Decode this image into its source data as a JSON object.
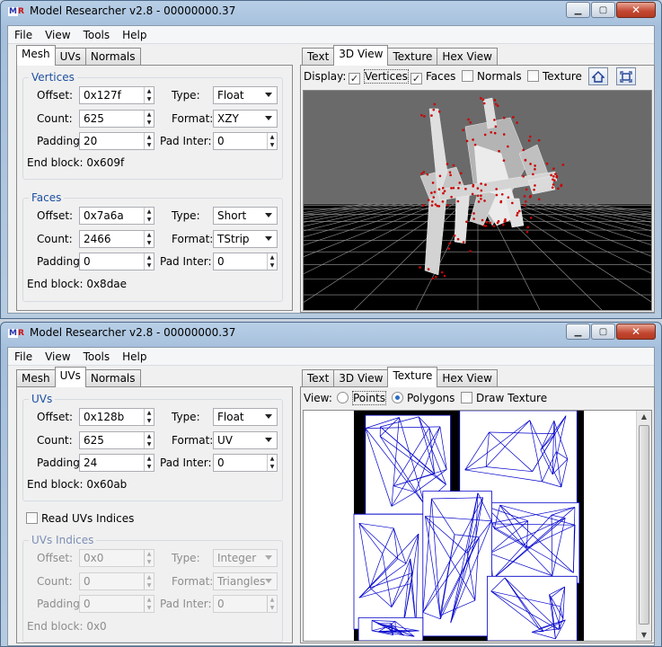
{
  "window1": {
    "title": "Model Researcher v2.8 - 00000000.37",
    "menu": [
      "File",
      "View",
      "Tools",
      "Help"
    ],
    "left_tabs": [
      "Mesh",
      "UVs",
      "Normals"
    ],
    "left_active": "Mesh",
    "vertices": {
      "title": "Vertices",
      "offset_label": "Offset:",
      "offset": "0x127f",
      "count_label": "Count:",
      "count": "625",
      "padding_label": "Padding:",
      "padding": "20",
      "type_label": "Type:",
      "type": "Float",
      "format_label": "Format:",
      "format": "XZY",
      "padinter_label": "Pad Inter:",
      "padinter": "0",
      "endblock": "End block: 0x609f"
    },
    "faces": {
      "title": "Faces",
      "offset_label": "Offset:",
      "offset": "0x7a6a",
      "count_label": "Count:",
      "count": "2466",
      "padding_label": "Padding:",
      "padding": "0",
      "type_label": "Type:",
      "type": "Short",
      "format_label": "Format:",
      "format": "TStrip",
      "padinter_label": "Pad Inter:",
      "padinter": "0",
      "endblock": "End block: 0x8dae"
    },
    "right_tabs": [
      "Text",
      "3D View",
      "Texture",
      "Hex View"
    ],
    "right_active": "3D View",
    "display_label": "Display:",
    "display_options": [
      {
        "label": "Vertices",
        "checked": true
      },
      {
        "label": "Faces",
        "checked": true
      },
      {
        "label": "Normals",
        "checked": false
      },
      {
        "label": "Texture",
        "checked": false
      }
    ]
  },
  "window2": {
    "title": "Model Researcher v2.8 - 00000000.37",
    "menu": [
      "File",
      "View",
      "Tools",
      "Help"
    ],
    "left_tabs": [
      "Mesh",
      "UVs",
      "Normals"
    ],
    "left_active": "UVs",
    "uvs": {
      "title": "UVs",
      "offset_label": "Offset:",
      "offset": "0x128b",
      "count_label": "Count:",
      "count": "625",
      "padding_label": "Padding:",
      "padding": "24",
      "type_label": "Type:",
      "type": "Float",
      "format_label": "Format:",
      "format": "UV",
      "padinter_label": "Pad Inter:",
      "padinter": "0",
      "endblock": "End block: 0x60ab"
    },
    "read_uv_indices": "Read UVs Indices",
    "uv_indices": {
      "title": "UVs Indices",
      "offset_label": "Offset:",
      "offset": "0x0",
      "count_label": "Count:",
      "count": "0",
      "padding_label": "Padding:",
      "padding": "0",
      "type_label": "Type:",
      "type": "Integer",
      "format_label": "Format:",
      "format": "Triangles",
      "padinter_label": "Pad Inter:",
      "padinter": "0",
      "endblock": "End block: 0x0"
    },
    "right_tabs": [
      "Text",
      "3D View",
      "Texture",
      "Hex View"
    ],
    "right_active": "Texture",
    "view_label": "View:",
    "view_options": [
      {
        "label": "Points",
        "selected": false
      },
      {
        "label": "Polygons",
        "selected": true
      }
    ],
    "draw_texture": "Draw Texture"
  },
  "colors": {
    "group_title": "#1e4fa0",
    "vertex_dot": "#cc0000",
    "uv_line": "#0000cc",
    "viewport_bg": "#666666"
  }
}
